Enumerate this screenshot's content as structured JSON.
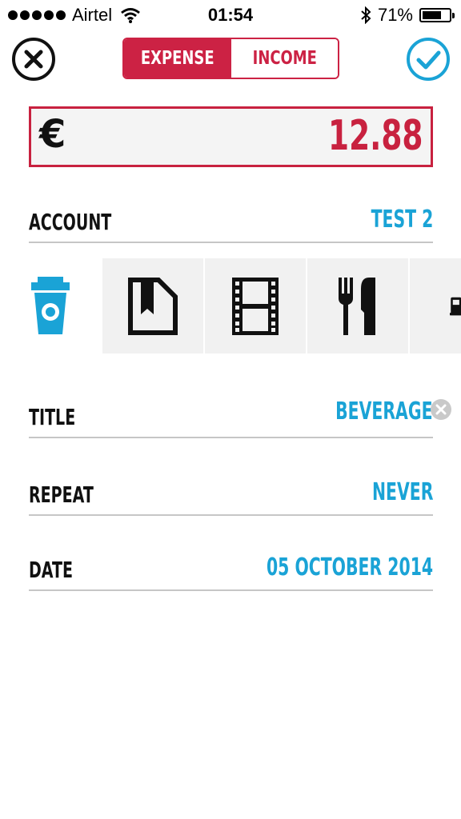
{
  "status_bar": {
    "carrier": "Airtel",
    "time": "01:54",
    "battery": "71%",
    "battery_level": 0.71,
    "icons": [
      "signal-dots",
      "wifi-icon",
      "bluetooth-icon",
      "battery-icon"
    ]
  },
  "nav": {
    "close_icon": "close-circle-icon",
    "done_icon": "checkmark-circle-icon",
    "segments": [
      {
        "label": "EXPENSE",
        "selected": true
      },
      {
        "label": "INCOME",
        "selected": false
      }
    ]
  },
  "amount": {
    "currency": "€",
    "value": "12.88"
  },
  "account": {
    "label": "ACCOUNT",
    "value": "TEST 2"
  },
  "categories": [
    {
      "icon": "coffee-cup-icon",
      "selected": true
    },
    {
      "icon": "book-icon",
      "selected": false
    },
    {
      "icon": "film-icon",
      "selected": false
    },
    {
      "icon": "cutlery-icon",
      "selected": false
    },
    {
      "icon": "fuel-pump-icon",
      "selected": false
    }
  ],
  "title_field": {
    "label": "TITLE",
    "value": "BEVERAGE",
    "clear_icon": "clear-icon"
  },
  "repeat": {
    "label": "REPEAT",
    "value": "NEVER"
  },
  "date": {
    "label": "DATE",
    "value": "05 OCTOBER 2014"
  },
  "colors": {
    "accent_red": "#c8213f",
    "accent_blue": "#1aa3d6"
  }
}
